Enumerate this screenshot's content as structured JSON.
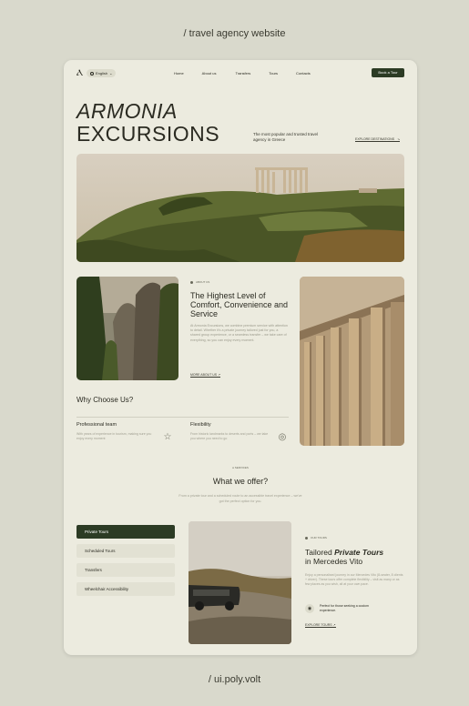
{
  "caption_top": "/ travel agency website",
  "caption_bottom": "/ ui.poly.volt",
  "header": {
    "logo": "Ⲁ",
    "language": "English",
    "nav": [
      "Home",
      "About us",
      "Transfers",
      "Tours",
      "Contacts"
    ],
    "book_button": "Book a Tour"
  },
  "hero": {
    "title_line1": "ARMONIA",
    "title_line2": "EXCURSIONS",
    "subtitle": "The most popular and trusted travel agency in Greece",
    "explore_link": "EXPLORE DESTINATIONS",
    "arrow": "↘"
  },
  "about": {
    "tag": "ABOUT US",
    "title": "The Highest Level of Comfort, Convenience and Service",
    "text": "At Armonia Excursions, we combine premium service with attention to detail. Whether it's a private journey tailored just for you, a shared group experience, or a seamless transfer – we take care of everything, so you can enjoy every moment.",
    "more_link": "MORE ABOUT US",
    "arrow": "↗"
  },
  "why": {
    "title": "Why Choose Us?",
    "features": [
      {
        "title": "Professional team",
        "text": "With years of experience in tourism, making sure you enjoy every moment",
        "icon": "☆"
      },
      {
        "title": "Flexibility",
        "text": "From historic landmarks to deserts and ports – we take you where you need to go",
        "icon": "◎"
      }
    ]
  },
  "offer": {
    "tag": "SERVICES",
    "title": "What we offer?",
    "subtitle": "From a private tour and a scheduled route to an accessible travel experience – we've got the perfect option for you.",
    "services": [
      "Private Tours",
      "Scheduled Tours",
      "Transfers",
      "Wheelchair Accessibility"
    ]
  },
  "tour": {
    "tag": "OUR TOURS",
    "title_pre": "Tailored ",
    "title_em": "Private Tours",
    "title_post": " in Mercedes Vito",
    "text": "Enjoy a personalised journey in our Mercedes Vito (8-seater, 8 clients + driver). These tours offer complete flexibility – visit as many or as few places as you wish, all at your own pace.",
    "perfect_icon": "◉",
    "perfect": "Perfect for those seeking a custom experience.",
    "explore_link": "EXPLORE TOURS",
    "arrow": "↗"
  },
  "colors": {
    "accent": "#2c3b24",
    "background": "#d9d9cc",
    "card": "#ecebdf"
  }
}
